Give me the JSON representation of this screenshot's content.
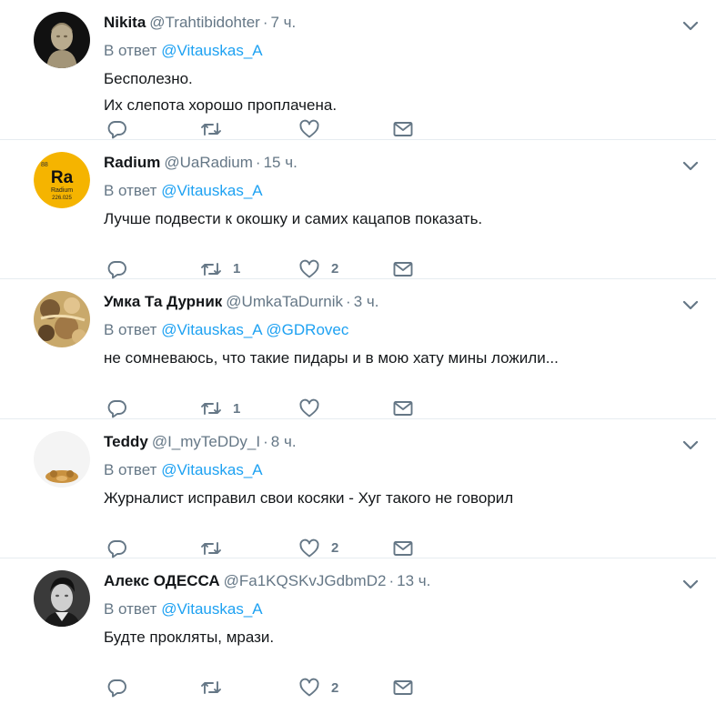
{
  "tweets": [
    {
      "name": "Nikita",
      "handle": "@Trahtibidohter",
      "time": "7 ч.",
      "reply_prefix": "В ответ",
      "mentions": "@Vitauskas_A",
      "lines": [
        "Бесполезно.",
        "Их слепота хорошо проплачена."
      ],
      "retweets": "",
      "likes": "",
      "avatar": "statue-bust"
    },
    {
      "name": "Radium",
      "handle": "@UaRadium",
      "time": "15 ч.",
      "reply_prefix": "В ответ",
      "mentions": "@Vitauskas_A",
      "lines": [
        "Лучше подвести к окошку и самих кацапов показать."
      ],
      "retweets": "1",
      "likes": "2",
      "avatar": "radium-element",
      "avatar_text": {
        "symbol": "Ra",
        "name": "Radium",
        "mass": "226.025",
        "number": "88"
      }
    },
    {
      "name": "Умка Та Дурник",
      "handle": "@UmkaTaDurnik",
      "time": "3 ч.",
      "reply_prefix": "В ответ",
      "mentions": "@Vitauskas_A @GDRovec",
      "lines": [
        "не сомневаюсь, что такие пидары и в мою хату мины ложили..."
      ],
      "retweets": "1",
      "likes": "",
      "avatar": "painting"
    },
    {
      "name": "Teddy",
      "handle": "@I_myTeDDy_I",
      "time": "8 ч.",
      "reply_prefix": "В ответ",
      "mentions": "@Vitauskas_A",
      "lines": [
        "Журналист исправил свои косяки - Хуг такого не говорил"
      ],
      "retweets": "",
      "likes": "2",
      "avatar": "teddy-bear"
    },
    {
      "name": "Алекс ОДЕССА",
      "handle": "@Fa1KQSKvJGdbmD2",
      "time": "13 ч.",
      "reply_prefix": "В ответ",
      "mentions": "@Vitauskas_A",
      "lines": [
        "Будте прокляты, мрази."
      ],
      "retweets": "",
      "likes": "2",
      "avatar": "bw-portrait"
    }
  ],
  "colors": {
    "link": "#1da1f2",
    "meta": "#657786",
    "text": "#14171a",
    "divider": "#e6ecf0"
  }
}
